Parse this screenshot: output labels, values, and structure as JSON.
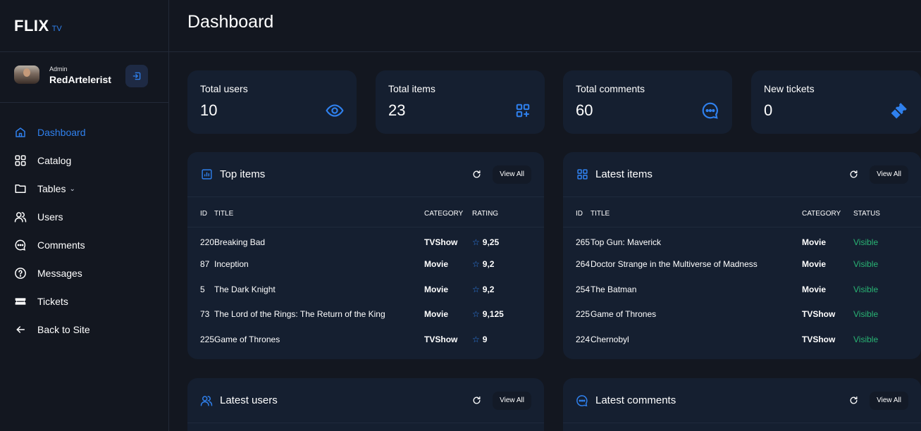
{
  "brand": {
    "name": "FLIX",
    "suffix": "TV"
  },
  "user": {
    "role": "Admin",
    "name": "RedArtelerist"
  },
  "nav": {
    "dashboard": "Dashboard",
    "catalog": "Catalog",
    "tables": "Tables",
    "users": "Users",
    "comments": "Comments",
    "messages": "Messages",
    "tickets": "Tickets",
    "back": "Back to Site"
  },
  "page_title": "Dashboard",
  "stats": [
    {
      "label": "Total users",
      "value": "10",
      "icon": "eye-icon"
    },
    {
      "label": "Total items",
      "value": "23",
      "icon": "grid-plus-icon"
    },
    {
      "label": "Total comments",
      "value": "60",
      "icon": "chat-icon"
    },
    {
      "label": "New tickets",
      "value": "0",
      "icon": "ticket-icon"
    }
  ],
  "top_items": {
    "title": "Top items",
    "view_all": "View All",
    "columns": [
      "ID",
      "TITLE",
      "CATEGORY",
      "RATING"
    ],
    "rows": [
      {
        "id": "220",
        "title": "Breaking Bad",
        "category": "TVShow",
        "rating": "9,25"
      },
      {
        "id": "87",
        "title": "Inception",
        "category": "Movie",
        "rating": "9,2"
      },
      {
        "id": "5",
        "title": "The Dark Knight",
        "category": "Movie",
        "rating": "9,2"
      },
      {
        "id": "73",
        "title": "The Lord of the Rings: The Return of the King",
        "category": "Movie",
        "rating": "9,125"
      },
      {
        "id": "225",
        "title": "Game of Thrones",
        "category": "TVShow",
        "rating": "9"
      }
    ]
  },
  "latest_items": {
    "title": "Latest items",
    "view_all": "View All",
    "columns": [
      "ID",
      "TITLE",
      "CATEGORY",
      "STATUS"
    ],
    "rows": [
      {
        "id": "265",
        "title": "Top Gun: Maverick",
        "category": "Movie",
        "status": "Visible"
      },
      {
        "id": "264",
        "title": "Doctor Strange in the Multiverse of Madness",
        "category": "Movie",
        "status": "Visible"
      },
      {
        "id": "254",
        "title": "The Batman",
        "category": "Movie",
        "status": "Visible"
      },
      {
        "id": "225",
        "title": "Game of Thrones",
        "category": "TVShow",
        "status": "Visible"
      },
      {
        "id": "224",
        "title": "Chernobyl",
        "category": "TVShow",
        "status": "Visible"
      }
    ]
  },
  "latest_users": {
    "title": "Latest users",
    "view_all": "View All"
  },
  "latest_comments": {
    "title": "Latest comments",
    "view_all": "View All"
  },
  "colors": {
    "accent": "#2f80ed",
    "visible": "#29b474",
    "panel": "#151f30",
    "background": "#131720"
  }
}
